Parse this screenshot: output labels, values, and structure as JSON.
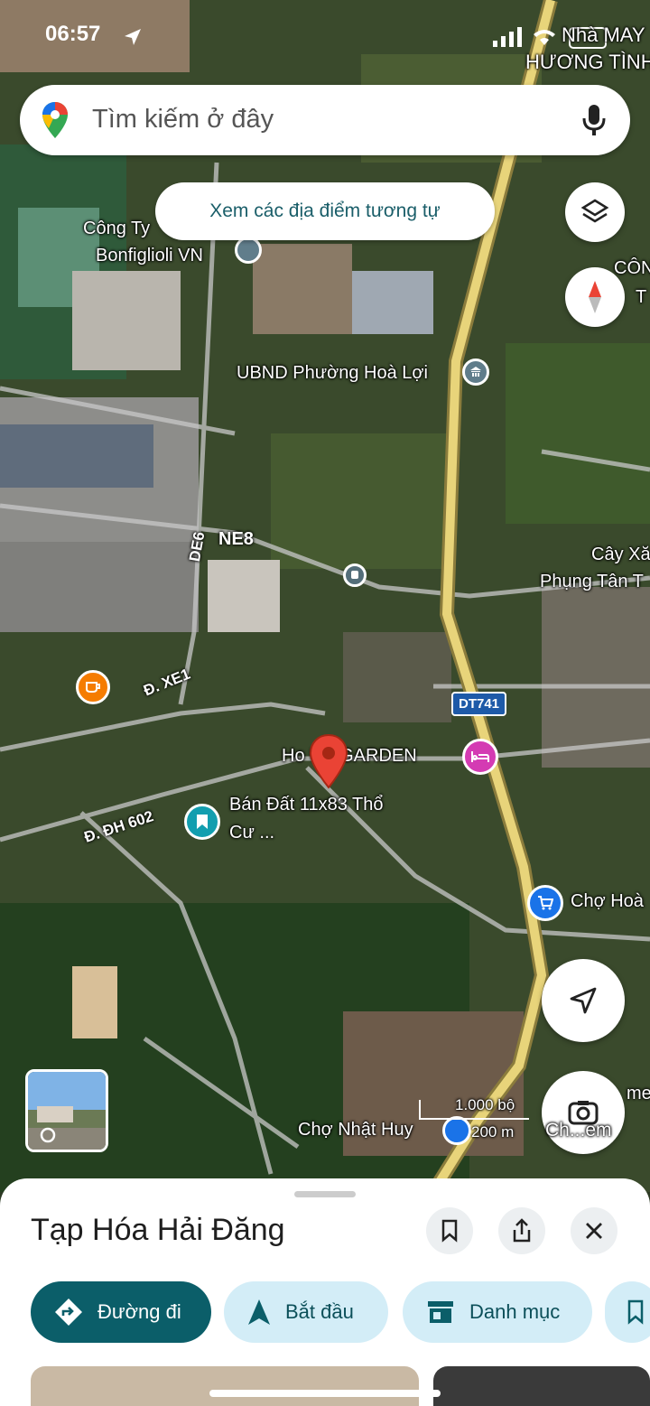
{
  "status_bar": {
    "time": "06:57",
    "carrier_overlay": "Nhà MAY",
    "carrier_overlay2": "HƯƠNG TÌNH"
  },
  "search": {
    "placeholder": "Tìm kiếm ở đây"
  },
  "similar_places_chip": "Xem các địa điểm tương tự",
  "map_labels": {
    "cong_ty": "Công Ty",
    "bonfiglioli": "Bonfiglioli VN",
    "ubnd": "UBND Phường Hoà Lợi",
    "ne8": "NE8",
    "de6": "DE6",
    "xe1": "Đ. XE1",
    "dh602": "Đ. ĐH 602",
    "dt741": "DT741",
    "garden": "Ho  UP GARDEN",
    "ban_dat_1": "Bán Đất 11x83 Thổ",
    "ban_dat_2": "Cư ...",
    "cho_hoa": "Chợ Hoà",
    "cay_xang_1": "Cây Xă",
    "cay_xang_2": "Phụng Tân T",
    "cong_right": "CÔNG",
    "cong_right2": "T",
    "cho_nhat_huy": "Chợ Nhật Huy",
    "me": "me",
    "scale_ft": "1.000 bộ",
    "scale_m": "200 m"
  },
  "lens_button": "Ch...em",
  "sheet": {
    "title": "Tạp Hóa Hải Đăng",
    "buttons": {
      "directions": "Đường đi",
      "start": "Bắt đầu",
      "category": "Danh mục"
    }
  },
  "colors": {
    "accent": "#0b5e69",
    "chip_bg": "#d3edf7",
    "road": "#e8d47a"
  },
  "icons": [
    "maps-pin-icon",
    "mic-icon",
    "layers-icon",
    "compass-icon",
    "my-location-icon",
    "lens-icon",
    "bookmark-icon",
    "share-icon",
    "close-icon",
    "directions-icon",
    "navigation-icon",
    "storefront-icon"
  ]
}
